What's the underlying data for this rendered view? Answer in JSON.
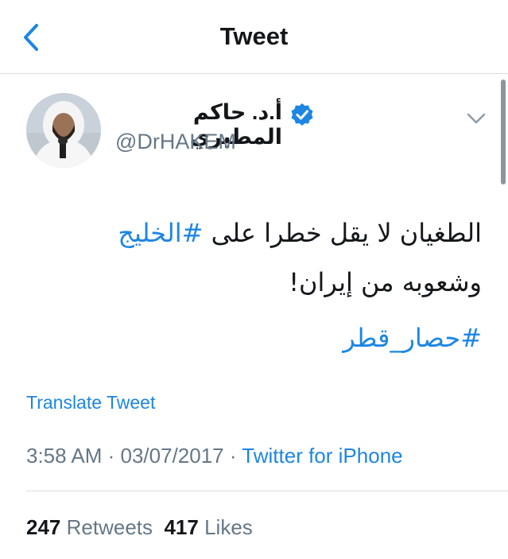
{
  "nav": {
    "title": "Tweet"
  },
  "author": {
    "display_name": "أ.د. حاكم المطيري",
    "username": "@DrHAKEM",
    "verified": true
  },
  "tweet": {
    "line1_text": "الطغيان لا يقل خطرا على ",
    "line1_hashtag": "#الخليج",
    "line2_text": "وشعوبه من إيران!",
    "hashtag2": "#حصار_قطر"
  },
  "translate_label": "Translate Tweet",
  "meta": {
    "time": "3:58 AM",
    "sep1": " · ",
    "date": "03/07/2017",
    "sep2": " · ",
    "source": "Twitter for iPhone"
  },
  "stats": {
    "retweets_count": "247",
    "retweets_label": "Retweets",
    "likes_count": "417",
    "likes_label": "Likes"
  },
  "colors": {
    "accent": "#1d86e3",
    "secondary_text": "#657786",
    "primary_text": "#14171a",
    "divider": "#d8dde2"
  }
}
